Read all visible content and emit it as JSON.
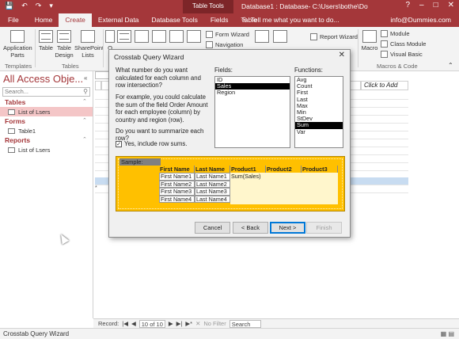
{
  "titlebar": {
    "context_tab": "Table Tools",
    "title": "Database1 : Database- C:\\Users\\bothe\\Downloads\\Arc...",
    "tabs": [
      "File",
      "Home",
      "Create",
      "External Data",
      "Database Tools",
      "Fields",
      "Table"
    ],
    "active_tab": "Create",
    "tell_me": "Tell me what you want to do...",
    "account": "info@Dummies.com"
  },
  "ribbon": {
    "buttons": {
      "application_parts": "Application Parts",
      "table": "Table",
      "table_design": "Table Design",
      "sharepoint_lists": "SharePoint Lists",
      "query_c": "Q",
      "query_wizard": "",
      "form_wizard": "Form Wizard",
      "navigation": "Navigation",
      "report_wizard": "Report Wizard",
      "macro": "Macro",
      "module": "Module",
      "class_module": "Class Module",
      "visual_basic": "Visual Basic"
    },
    "groups": {
      "templates": "Templates",
      "tables": "Tables",
      "macros_code": "Macros & Code"
    }
  },
  "nav": {
    "title": "All Access Obje...",
    "search_placeholder": "Search...",
    "sections": [
      {
        "label": "Tables",
        "items": [
          "List of Lsers"
        ]
      },
      {
        "label": "Forms",
        "items": [
          "Table1"
        ]
      },
      {
        "label": "Reports",
        "items": [
          "List of Lsers"
        ]
      }
    ]
  },
  "sheet": {
    "click_to_add": "Click to Add",
    "new_record_marker": "*"
  },
  "dialog": {
    "title": "Crosstab Query Wizard",
    "close": "✕",
    "question": "What number do you want calculated for each column and row intersection?",
    "example": "For example, you could calculate the sum of the field Order Amount for each employee (column) by country and region (row).",
    "summarize_q": "Do you want to summarize each row?",
    "checkbox_label": "Yes, include row sums.",
    "checkbox_checked": true,
    "fields_label": "Fields:",
    "fields": [
      "ID",
      "Sales",
      "Region"
    ],
    "fields_selected": "Sales",
    "functions_label": "Functions:",
    "functions": [
      "Avg",
      "Count",
      "First",
      "Last",
      "Max",
      "Min",
      "StDev",
      "Sum",
      "Var"
    ],
    "functions_selected": "Sum",
    "sample": {
      "label": "Sample:",
      "headers": [
        "First Name",
        "Last Name",
        "Product1",
        "Product2",
        "Product3"
      ],
      "rows": [
        [
          "First Name1",
          "Last Name1"
        ],
        [
          "First Name2",
          "Last Name2"
        ],
        [
          "First Name3",
          "Last Name3"
        ],
        [
          "First Name4",
          "Last Name4"
        ]
      ],
      "value_text": "Sum(Sales)"
    },
    "buttons": {
      "cancel": "Cancel",
      "back": "< Back",
      "next": "Next >",
      "finish": "Finish"
    }
  },
  "recordbar": {
    "label": "Record:",
    "position": "10 of 10",
    "filter": "No Filter",
    "search": "Search"
  },
  "status": {
    "text": "Crosstab Query Wizard"
  }
}
